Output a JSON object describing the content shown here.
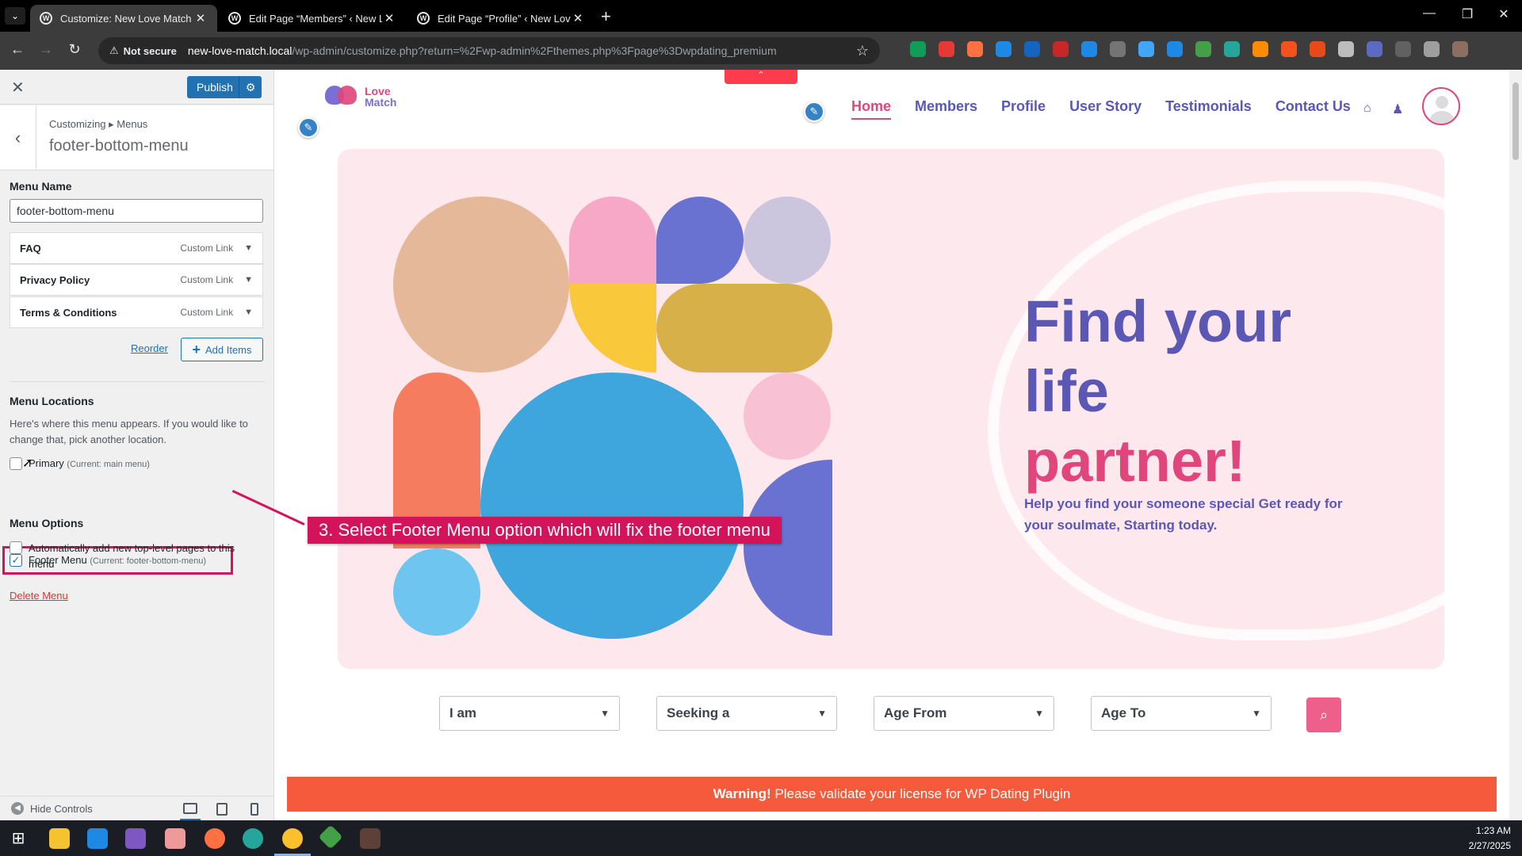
{
  "browser": {
    "tabs": [
      {
        "title": "Customize: New Love Match",
        "active": true
      },
      {
        "title": "Edit Page “Members” ‹ New Lo",
        "active": false
      },
      {
        "title": "Edit Page “Profile” ‹ New Love M",
        "active": false
      }
    ],
    "new_tab": "+",
    "security_label": "Not secure",
    "url_host": "new-love-match.local",
    "url_path": "/wp-admin/customize.php?return=%2Fwp-admin%2Fthemes.php%3Fpage%3Dwpdating_premium",
    "extension_colors": [
      "#0f9d58",
      "#e53935",
      "#ff7043",
      "#1e88e5",
      "#1565c0",
      "#c62828",
      "#1e88e5",
      "#757575",
      "#42a5f5",
      "#1e88e5",
      "#43a047",
      "#26a69a",
      "#fb8c00",
      "#f4511e",
      "#e64a19",
      "#bdbdbd",
      "#5c6bc0",
      "#616161",
      "#9e9e9e",
      "#8d6e63"
    ]
  },
  "customizer": {
    "publish_label": "Publish",
    "breadcrumb": "Customizing ▸ Menus",
    "section_title": "footer-bottom-menu",
    "menu_name_label": "Menu Name",
    "menu_name_value": "footer-bottom-menu",
    "items": [
      {
        "title": "FAQ",
        "type": "Custom Link"
      },
      {
        "title": "Privacy Policy",
        "type": "Custom Link"
      },
      {
        "title": "Terms & Conditions",
        "type": "Custom Link"
      }
    ],
    "reorder_label": "Reorder",
    "add_items_label": "Add Items",
    "locations_heading": "Menu Locations",
    "locations_desc": "Here's where this menu appears. If you would like to change that, pick another location.",
    "primary_label": "Primary",
    "primary_current": "(Current: main menu)",
    "footer_label": "Footer Menu",
    "footer_current": "(Current: footer-bottom-menu)",
    "options_heading": "Menu Options",
    "auto_add_label": "Automatically add new top-level pages to this menu",
    "delete_label": "Delete Menu",
    "hide_controls_label": "Hide Controls"
  },
  "annotation": {
    "callout_text": "3. Select Footer Menu option which will fix the footer menu",
    "color": "#d4145a"
  },
  "site": {
    "logo_line1": "Love",
    "logo_line2": "Match",
    "nav": [
      "Home",
      "Members",
      "Profile",
      "User Story",
      "Testimonials",
      "Contact Us"
    ],
    "headline_line1": "Find your",
    "headline_line2": "life",
    "headline_line3": "partner!",
    "subline": "Help you find your someone special Get ready for your soulmate, Starting today.",
    "filters": [
      "I am",
      "Seeking a",
      "Age From",
      "Age To"
    ],
    "warning_bold": "Warning!",
    "warning_text": " Please validate your license for WP Dating Plugin",
    "brand_pink": "#e0457b",
    "brand_purple": "#5b57b5"
  },
  "taskbar": {
    "time": "1:23 AM",
    "date": "2/27/2025"
  }
}
